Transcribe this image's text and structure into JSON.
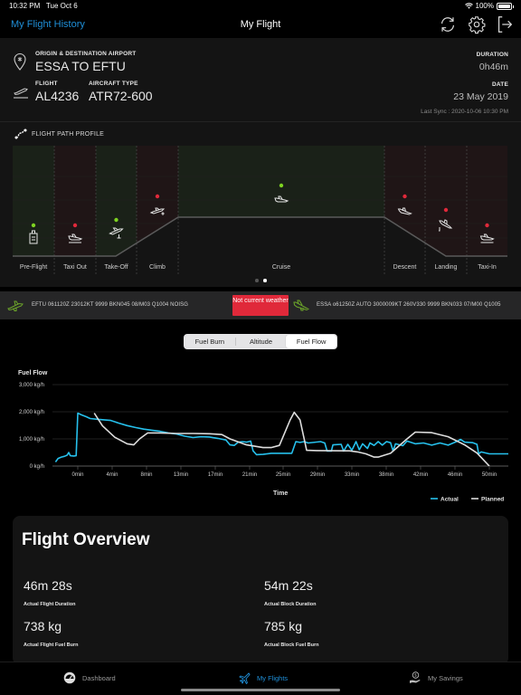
{
  "status_bar": {
    "time": "10:32 PM",
    "date": "Tue Oct 6",
    "battery": "100%",
    "battery_level": 1.0
  },
  "nav": {
    "back_label": "My Flight History",
    "title": "My Flight",
    "icons": [
      "refresh-icon",
      "gear-icon",
      "logout-icon"
    ]
  },
  "header": {
    "origin_dest_label": "ORIGIN & DESTINATION AIRPORT",
    "origin_dest_value": "ESSA TO EFTU",
    "flight_label": "FLIGHT",
    "flight_value": "AL4236",
    "aircraft_label": "AIRCRAFT TYPE",
    "aircraft_value": "ATR72-600",
    "duration_label": "DURATION",
    "duration_value": "0h46m",
    "date_label": "DATE",
    "date_value": "23 May 2019",
    "last_sync": "Last Sync : 2020-10-06 10:30 PM"
  },
  "flight_path": {
    "title": "FLIGHT PATH PROFILE",
    "colors": {
      "good": "#7ed321",
      "bad": "#e0293a",
      "good_bg": "#1a2118",
      "bad_bg": "#1f1516"
    },
    "phases": [
      {
        "label": "Pre-Flight",
        "status": "good",
        "icon": "checklist-icon"
      },
      {
        "label": "Taxi Out",
        "status": "bad",
        "icon": "taxi-out-icon"
      },
      {
        "label": "Take-Off",
        "status": "good",
        "icon": "takeoff-icon"
      },
      {
        "label": "Climb",
        "status": "bad",
        "icon": "climb-icon"
      },
      {
        "label": "Cruise",
        "status": "good",
        "icon": "cruise-icon"
      },
      {
        "label": "Descent",
        "status": "bad",
        "icon": "descent-icon"
      },
      {
        "label": "Landing",
        "status": "bad",
        "icon": "landing-icon"
      },
      {
        "label": "Taxi-In",
        "status": "bad",
        "icon": "taxi-in-icon"
      }
    ],
    "page": 2,
    "pages": 2
  },
  "weather": {
    "origin_metar": "EFTU 061120Z 23012KT 9999 BKN045 08/M03 Q1004 NOISG",
    "warning": "Not current weather",
    "dest_metar": "ESSA o61250Z AUTO 3000009KT 260V330 9999 BKN033 07/M00 Q1005"
  },
  "segments": {
    "items": [
      "Fuel Burn",
      "Altitude",
      "Fuel Flow"
    ],
    "active": 2
  },
  "chart_data": {
    "type": "line",
    "title": "Fuel Flow",
    "xlabel": "Time",
    "ylabel": "",
    "x_ticks": [
      "0min",
      "4min",
      "8min",
      "13min",
      "17min",
      "21min",
      "25min",
      "29min",
      "33min",
      "38min",
      "42min",
      "46min",
      "50min"
    ],
    "y_ticks": [
      "0 kg/h",
      "1,000 kg/h",
      "2,000 kg/h",
      "3,000 kg/h"
    ],
    "ylim": [
      0,
      3000
    ],
    "xlim": [
      -3,
      52
    ],
    "grid": true,
    "legend": "bottom-right",
    "series": [
      {
        "name": "Actual",
        "color": "#26c0ec",
        "points": [
          [
            -2.7,
            150
          ],
          [
            -2.4,
            280
          ],
          [
            -2,
            330
          ],
          [
            -1.6,
            360
          ],
          [
            -1.3,
            400
          ],
          [
            -1.1,
            500
          ],
          [
            -0.9,
            380
          ],
          [
            -0.5,
            370
          ],
          [
            -0.2,
            380
          ],
          [
            0,
            1950
          ],
          [
            0.5,
            1880
          ],
          [
            1,
            1820
          ],
          [
            1.5,
            1750
          ],
          [
            2.5,
            1720
          ],
          [
            4,
            1680
          ],
          [
            5,
            1580
          ],
          [
            6,
            1490
          ],
          [
            7,
            1420
          ],
          [
            8,
            1360
          ],
          [
            9,
            1320
          ],
          [
            10,
            1280
          ],
          [
            11,
            1220
          ],
          [
            12,
            1180
          ],
          [
            13,
            1100
          ],
          [
            14,
            1050
          ],
          [
            15,
            1080
          ],
          [
            16,
            1070
          ],
          [
            17,
            1020
          ],
          [
            18,
            960
          ],
          [
            18.5,
            780
          ],
          [
            19,
            760
          ],
          [
            19.5,
            880
          ],
          [
            20,
            900
          ],
          [
            20.5,
            880
          ],
          [
            21,
            920
          ],
          [
            21.3,
            560
          ],
          [
            21.7,
            420
          ],
          [
            22.5,
            430
          ],
          [
            23.5,
            470
          ],
          [
            25,
            470
          ],
          [
            26,
            470
          ],
          [
            26.5,
            900
          ],
          [
            27,
            870
          ],
          [
            27.5,
            900
          ],
          [
            28,
            850
          ],
          [
            29.5,
            900
          ],
          [
            30,
            850
          ],
          [
            30.3,
            550
          ],
          [
            30.8,
            550
          ],
          [
            31,
            780
          ],
          [
            32,
            800
          ],
          [
            32.3,
            550
          ],
          [
            32.8,
            800
          ],
          [
            33.3,
            580
          ],
          [
            33.8,
            900
          ],
          [
            34.2,
            600
          ],
          [
            34.6,
            820
          ],
          [
            35.2,
            650
          ],
          [
            35.5,
            850
          ],
          [
            36,
            760
          ],
          [
            36.5,
            900
          ],
          [
            37,
            770
          ],
          [
            37.5,
            900
          ],
          [
            38,
            860
          ],
          [
            38.3,
            560
          ],
          [
            38.6,
            820
          ],
          [
            39.5,
            750
          ],
          [
            40,
            920
          ],
          [
            41,
            820
          ],
          [
            42,
            850
          ],
          [
            43,
            770
          ],
          [
            44,
            850
          ],
          [
            45,
            770
          ],
          [
            46,
            900
          ],
          [
            46.5,
            980
          ],
          [
            47,
            880
          ],
          [
            48,
            860
          ],
          [
            48.5,
            800
          ],
          [
            48.7,
            450
          ],
          [
            49,
            520
          ],
          [
            50,
            450
          ],
          [
            53,
            450
          ],
          [
            56,
            450
          ],
          [
            58,
            470
          ],
          [
            59,
            420
          ]
        ]
      },
      {
        "name": "Planned",
        "color": "#dddddd",
        "points": [
          [
            2,
            1950
          ],
          [
            3,
            1480
          ],
          [
            4.5,
            1060
          ],
          [
            6,
            820
          ],
          [
            6.8,
            780
          ],
          [
            7.5,
            1000
          ],
          [
            8.5,
            1220
          ],
          [
            10,
            1220
          ],
          [
            12,
            1200
          ],
          [
            14,
            1200
          ],
          [
            16,
            1190
          ],
          [
            17.5,
            1160
          ],
          [
            18.5,
            1000
          ],
          [
            20.5,
            780
          ],
          [
            22.5,
            680
          ],
          [
            23.5,
            680
          ],
          [
            24.5,
            760
          ],
          [
            25.8,
            1700
          ],
          [
            26.3,
            1980
          ],
          [
            27,
            1700
          ],
          [
            27.8,
            580
          ],
          [
            29,
            570
          ],
          [
            33,
            560
          ],
          [
            34,
            520
          ],
          [
            35,
            450
          ],
          [
            36,
            330
          ],
          [
            36.5,
            330
          ],
          [
            38,
            470
          ],
          [
            40,
            1000
          ],
          [
            41,
            1250
          ],
          [
            43,
            1230
          ],
          [
            45,
            1080
          ],
          [
            47,
            780
          ],
          [
            48.5,
            480
          ],
          [
            50,
            0
          ]
        ]
      }
    ]
  },
  "overview": {
    "title": "Flight Overview",
    "stats": [
      {
        "value": "46m 28s",
        "label": "Actual Flight Duration"
      },
      {
        "value": "54m 22s",
        "label": "Actual Block Duration"
      },
      {
        "value": "738 kg",
        "label": "Actual Flight Fuel Burn"
      },
      {
        "value": "785 kg",
        "label": "Actual Block Fuel Burn"
      }
    ]
  },
  "tabbar": {
    "items": [
      {
        "label": "Dashboard",
        "icon": "dashboard-icon"
      },
      {
        "label": "My Flights",
        "icon": "plane-icon"
      },
      {
        "label": "My Savings",
        "icon": "savings-icon"
      }
    ],
    "active": 1,
    "accent": "#1f8fd8"
  }
}
